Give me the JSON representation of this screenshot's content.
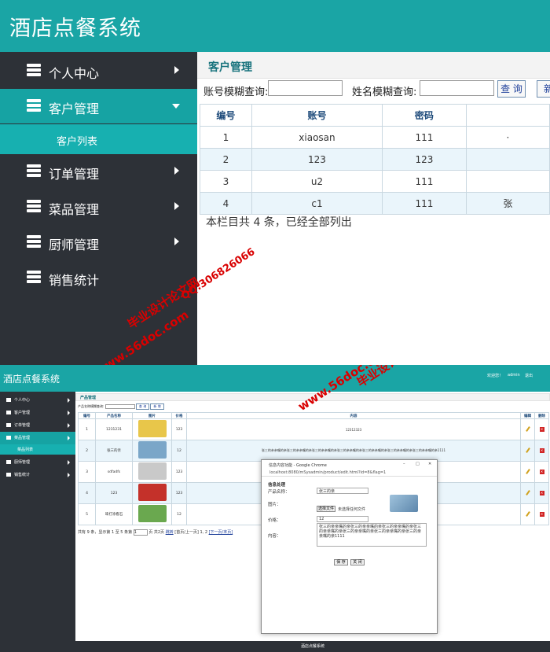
{
  "top": {
    "app_title": "酒店点餐系统",
    "menu": [
      {
        "label": "个人中心",
        "active": false
      },
      {
        "label": "客户管理",
        "active": true
      },
      {
        "label": "订单管理",
        "active": false
      },
      {
        "label": "菜品管理",
        "active": false
      },
      {
        "label": "厨师管理",
        "active": false
      },
      {
        "label": "销售统计",
        "active": false
      }
    ],
    "submenu_label": "客户列表",
    "page_title": "客户管理",
    "search": {
      "account_label": "账号模糊查询:",
      "name_label": "姓名模糊查询:",
      "query_button": "查 询",
      "add_button": "新"
    },
    "table": {
      "headers": [
        "编号",
        "账号",
        "密码",
        ""
      ],
      "rows": [
        [
          "1",
          "xiaosan",
          "111",
          "·"
        ],
        [
          "2",
          "123",
          "123",
          ""
        ],
        [
          "3",
          "u2",
          "111",
          ""
        ],
        [
          "4",
          "c1",
          "111",
          "张"
        ]
      ]
    },
    "summary": "本栏目共 4 条，已经全部列出"
  },
  "watermark": {
    "site": "www.56doc.com",
    "thesis": "毕业设计论文网",
    "qq": "QQ:306826066"
  },
  "bottom": {
    "app_title": "酒店点餐系统",
    "header_right": [
      "欢迎您！",
      "admin",
      "退出"
    ],
    "menu": [
      {
        "label": "个人中心",
        "active": false
      },
      {
        "label": "客户管理",
        "active": false
      },
      {
        "label": "订单管理",
        "active": false
      },
      {
        "label": "菜品管理",
        "active": true
      },
      {
        "label": "厨师管理",
        "active": false
      },
      {
        "label": "销售统计",
        "active": false
      }
    ],
    "submenu_label": "菜品列表",
    "page_title": "产品管理",
    "search_label": "产品名称模糊查询:",
    "query_button": "查 询",
    "add_button": "新 增",
    "table": {
      "headers": [
        "编号",
        "产品名称",
        "图片",
        "价格",
        "内容",
        "编辑",
        "删除"
      ],
      "rows": [
        {
          "id": "1",
          "name": "1231231",
          "price": "123",
          "content": "12312323",
          "pic_color": "#e8c64a"
        },
        {
          "id": "2",
          "name": "张三的亲",
          "price": "12",
          "content": "张三的亲亲嘴的亲张三的亲亲嘴的亲张三的亲亲嘴的亲张三的亲亲嘴的亲张三的亲亲嘴的亲张三的亲亲嘴的亲张三的亲亲嘴的亲1111",
          "pic_color": "#7aa6c8"
        },
        {
          "id": "3",
          "name": "sdfadfs",
          "price": "123",
          "content": "",
          "pic_color": "#c9c9c9"
        },
        {
          "id": "4",
          "name": "123",
          "price": "123",
          "content": "",
          "pic_color": "#c4312a"
        },
        {
          "id": "5",
          "name": "味打涂看石",
          "price": "12",
          "content": "",
          "pic_color": "#6aa84f"
        }
      ]
    },
    "pager": {
      "text": "共有 9 条，显示第 1 至 5 条第",
      "page_input": "1",
      "total_pages": "页 共2页",
      "jump": "跳转",
      "nav_prefix": "[首页/上一页]",
      "page_links": "1, 2",
      "nav_suffix": "[下一页/末页]"
    },
    "footer": "酒店点餐系统",
    "dialog": {
      "window_title": "信息内容功能 - Google Chrome",
      "url": "localhost:8080/mSysadmin/product/edit.html?id=8&flag=1",
      "form_title": "信息处理",
      "name_label": "产品名称：",
      "name_value": "张三的亲",
      "image_label": "图片：",
      "choose_file": "选择文件",
      "no_file": "未选择任何文件",
      "price_label": "价格：",
      "price_value": "12",
      "content_label": "内容：",
      "content_value": "张三的亲亲嘴的亲张三的亲亲嘴的亲张三的亲亲嘴的亲张三的亲亲嘴的亲张三的亲亲嘴的亲张三的亲亲嘴的亲张三的亲亲嘴的亲1111",
      "save_button": "保 存",
      "close_button": "关 闭"
    }
  }
}
